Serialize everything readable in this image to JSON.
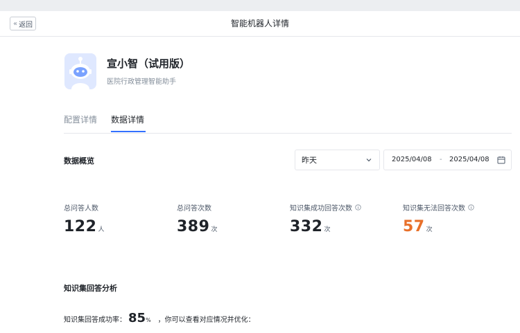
{
  "header": {
    "back_label": "返回",
    "title": "智能机器人详情"
  },
  "bot": {
    "name": "宣小智（试用版）",
    "description": "医院行政管理智能助手"
  },
  "tabs": [
    {
      "label": "配置详情",
      "active": false
    },
    {
      "label": "数据详情",
      "active": true
    }
  ],
  "overview": {
    "title": "数据概览",
    "period_select": "昨天",
    "date_start": "2025/04/08",
    "date_sep": "-",
    "date_end": "2025/04/08"
  },
  "stats": [
    {
      "label": "总问答人数",
      "value": "122",
      "unit": "人",
      "info": false
    },
    {
      "label": "总问答次数",
      "value": "389",
      "unit": "次",
      "info": false
    },
    {
      "label": "知识集成功回答次数",
      "value": "332",
      "unit": "次",
      "info": true
    },
    {
      "label": "知识集无法回答次数",
      "value": "57",
      "unit": "次",
      "info": true,
      "color": "#e8702a"
    }
  ],
  "analysis": {
    "title": "知识集回答分析",
    "rate_prefix": "知识集回答成功率：",
    "rate_value": "85",
    "rate_unit": "%",
    "rate_suffix": "，你可以查看对应情况并优化："
  },
  "colors": {
    "accent": "#3370ff",
    "warning": "#e8702a",
    "highlight": "#8ee0a6"
  }
}
